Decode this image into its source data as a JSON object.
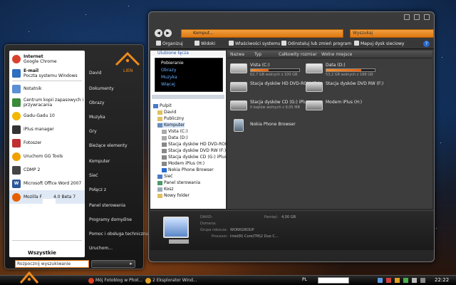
{
  "start_menu": {
    "left_items": [
      {
        "title": "Internet",
        "subtitle": "Google Chrome",
        "color": "#d9412f"
      },
      {
        "title": "E-mail",
        "subtitle": "Poczta systemu Windows",
        "color": "#2f6fbf"
      },
      {
        "title": "Notatnik",
        "subtitle": "",
        "color": "#5b8fd6"
      },
      {
        "title": "Centrum kopii zapasowych i",
        "subtitle": "przywracania",
        "color": "#3a8a3a"
      },
      {
        "title": "Gadu-Gadu 10",
        "subtitle": "",
        "color": "#f2b800"
      },
      {
        "title": "iPlus manager",
        "subtitle": "",
        "color": "#333333"
      },
      {
        "title": "Fotoszer",
        "subtitle": "",
        "color": "#c03030"
      },
      {
        "title": "Uruchom GG Tools",
        "subtitle": "",
        "color": "#f2a000"
      },
      {
        "title": "CDMP 2",
        "subtitle": "",
        "color": "#444444"
      },
      {
        "title": "Microsoft Office Word 2007",
        "subtitle": "",
        "color": "#2b579a"
      },
      {
        "title": "Mozilla F",
        "subtitle": "",
        "suffix": "4.0 Beta 7",
        "color": "#e66000"
      }
    ],
    "all_programs": "Wszystkie programy",
    "right_items": [
      "David",
      "Dokumenty",
      "Obrazy",
      "Muzyka",
      "Gry",
      "Bieżące elementy",
      "Komputer",
      "Sieć",
      "Połącz z",
      "Panel sterowania",
      "Programy domyślne",
      "Pomoc i obsługa techniczna",
      "Uruchom..."
    ],
    "search_placeholder": "Rozpocznij wyszukiwanie",
    "logo_text": "LIEN"
  },
  "explorer": {
    "address": "Komput...",
    "search_placeholder": "Wyszukaj",
    "toolbar": [
      "Organizuj",
      "Widoki",
      "Właściwości systemu",
      "Odinstaluj lub zmień program",
      "Mapuj dysk sieciowy"
    ],
    "favorites_header": "Ulubione łącza",
    "favorites": [
      "Pobieranie",
      "Obrazy",
      "Muzyka",
      "Więcej"
    ],
    "tree": [
      {
        "label": "Pulpit",
        "indent": 0
      },
      {
        "label": "David",
        "indent": 1
      },
      {
        "label": "Publiczny",
        "indent": 1
      },
      {
        "label": "Komputer",
        "indent": 1
      },
      {
        "label": "Vista (C:)",
        "indent": 2
      },
      {
        "label": "Data (D:)",
        "indent": 2
      },
      {
        "label": "Stacja dysków HD DVD-ROM (",
        "indent": 2
      },
      {
        "label": "Stacja dysków DVD RW (F:)",
        "indent": 2
      },
      {
        "label": "Stacja dysków CD (G:) iPlus",
        "indent": 2
      },
      {
        "label": "Modem iPlus (H:)",
        "indent": 2
      },
      {
        "label": "Nokia Phone Browser",
        "indent": 2
      },
      {
        "label": "Sieć",
        "indent": 1
      },
      {
        "label": "Panel sterowania",
        "indent": 1
      },
      {
        "label": "Kosz",
        "indent": 1
      },
      {
        "label": "Nowy folder",
        "indent": 1
      }
    ],
    "columns": [
      "Nazwa",
      "Typ",
      "Całkowity rozmiar",
      "Wolne miejsce"
    ],
    "drives": [
      {
        "name": "Vista (C:)",
        "sub": "62,7 GB wolnych z 100 GB",
        "used": 0.37
      },
      {
        "name": "Data (D:)",
        "sub": "53,2 GB wolnych z 188 GB",
        "used": 0.72
      },
      {
        "name": "Stacja dysków HD DVD-ROM (E:)",
        "sub": ""
      },
      {
        "name": "Stacja dysków DVD RW (F:)",
        "sub": ""
      },
      {
        "name": "Stacja dysków CD (G:) iPlus",
        "sub": "0 bajtów wolnych z 9,05 MB"
      },
      {
        "name": "Modem iPlus (H:)",
        "sub": ""
      },
      {
        "name": "Nokia Phone Browser",
        "sub": ""
      }
    ],
    "details": {
      "name_label": "DAVID-",
      "memory_label": "Pamięć:",
      "memory_value": "4,00 GB",
      "domain_label": "Domena:",
      "group_label": "Grupa robocza:",
      "group_value": "WORKGROUP",
      "cpu_label": "Procesor:",
      "cpu_value": "Intel(R) Core(TM)2 Duo C..."
    }
  },
  "taskbar": {
    "tasks": [
      {
        "label": "Mój Fotoblog w Phot...",
        "color": "#e04020"
      },
      {
        "label": "2  Eksplorator Wind...",
        "color": "#e0a020"
      }
    ],
    "language": "PL",
    "clock": "22:22"
  }
}
